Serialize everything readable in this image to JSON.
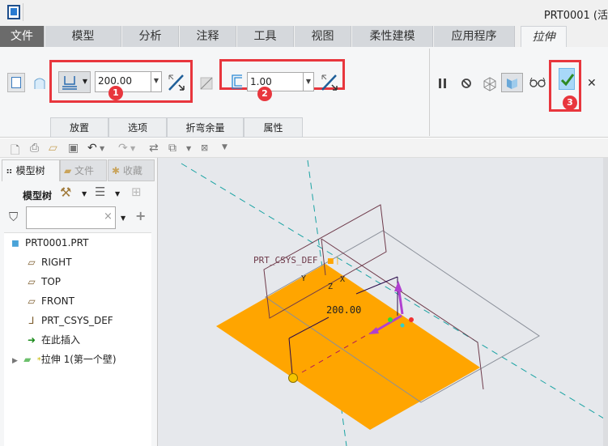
{
  "title": {
    "text": "PRT0001 (活"
  },
  "menu_tabs": [
    {
      "label": "文件"
    },
    {
      "label": "模型"
    },
    {
      "label": "分析"
    },
    {
      "label": "注释"
    },
    {
      "label": "工具"
    },
    {
      "label": "视图"
    },
    {
      "label": "柔性建模"
    },
    {
      "label": "应用程序"
    },
    {
      "label": "拉伸"
    }
  ],
  "ribbon": {
    "depth_value": "200.00",
    "thickness_value": "1.00",
    "badges": [
      "1",
      "2",
      "3"
    ],
    "sub_tabs": [
      {
        "label": "放置"
      },
      {
        "label": "选项"
      },
      {
        "label": "折弯余量"
      },
      {
        "label": "属性"
      }
    ]
  },
  "left_panel": {
    "tabs": [
      {
        "label": "模型树"
      },
      {
        "label": "文件"
      },
      {
        "label": "收藏"
      }
    ],
    "tree_label": "模型树",
    "filter_value": "",
    "tree": [
      {
        "label": "PRT0001.PRT",
        "icon": "part-icon"
      },
      {
        "label": "RIGHT",
        "icon": "datum-plane-icon"
      },
      {
        "label": "TOP",
        "icon": "datum-plane-icon"
      },
      {
        "label": "FRONT",
        "icon": "datum-plane-icon"
      },
      {
        "label": "PRT_CSYS_DEF",
        "icon": "csys-icon"
      },
      {
        "label": "在此插入",
        "icon": "insert-here-arrow-icon"
      },
      {
        "label": "拉伸 1(第一个壁)",
        "icon": "extrude-wall-icon"
      }
    ]
  },
  "viewport": {
    "csys_label": "PRT_CSYS_DEF",
    "x_axis": "X",
    "y_axis": "Y",
    "z_axis": "Z",
    "dimension": "200.00",
    "plane_color": "#ffa500"
  },
  "colors": {
    "accent_red": "#e8363d",
    "file_tab": "#6b6b6b",
    "plane": "#ffa500"
  }
}
